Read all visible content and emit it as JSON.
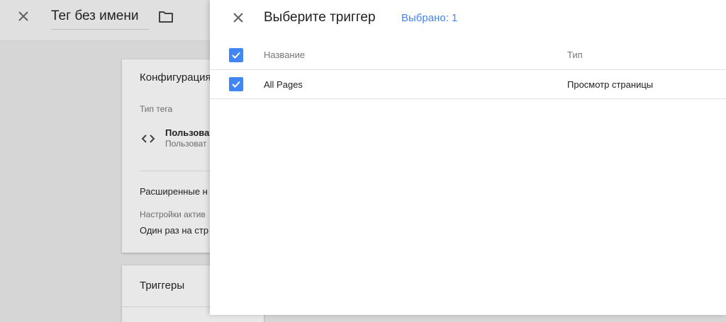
{
  "background": {
    "header": {
      "title": "Тег без имени"
    },
    "config_card": {
      "title": "Конфигурация",
      "tag_type_label": "Тип тега",
      "tag_name": "Пользоват",
      "tag_sub": "Пользоват",
      "advanced_label": "Расширенные н",
      "trigger_settings_label": "Настройки актив",
      "trigger_settings_value": "Один раз на стр"
    },
    "triggers_card": {
      "title": "Триггеры"
    }
  },
  "panel": {
    "title": "Выберите триггер",
    "selected_count": "Выбрано: 1",
    "table": {
      "headers": {
        "name": "Название",
        "type": "Тип"
      },
      "rows": [
        {
          "name": "All Pages",
          "type": "Просмотр страницы",
          "checked": true
        }
      ]
    }
  },
  "colors": {
    "accent": "#4285f4",
    "panel_bg": "#ffffff",
    "backdrop": "#d6d6d6"
  },
  "icons": [
    "close-icon",
    "folder-icon",
    "code-icon",
    "checkbox-checked-icon"
  ]
}
